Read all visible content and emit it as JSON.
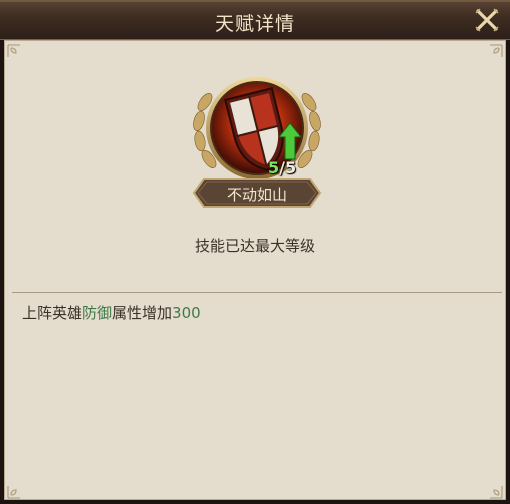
{
  "header": {
    "title": "天赋详情",
    "close_icon": "close-icon"
  },
  "talent": {
    "icon": "shield-icon",
    "upgrade_icon": "arrow-up-icon",
    "level_current": "5",
    "level_separator": "/",
    "level_max": "5",
    "name": "不动如山",
    "max_level_text": "技能已达最大等级"
  },
  "effect": {
    "prefix": "上阵英雄",
    "attribute": "防御",
    "middle": "属性增加",
    "amount": "300"
  },
  "colors": {
    "highlight": "#3d7a46",
    "level_current": "#7ce35a",
    "panel_bg": "#e4dccd",
    "header_bg": "#3d2c21"
  }
}
